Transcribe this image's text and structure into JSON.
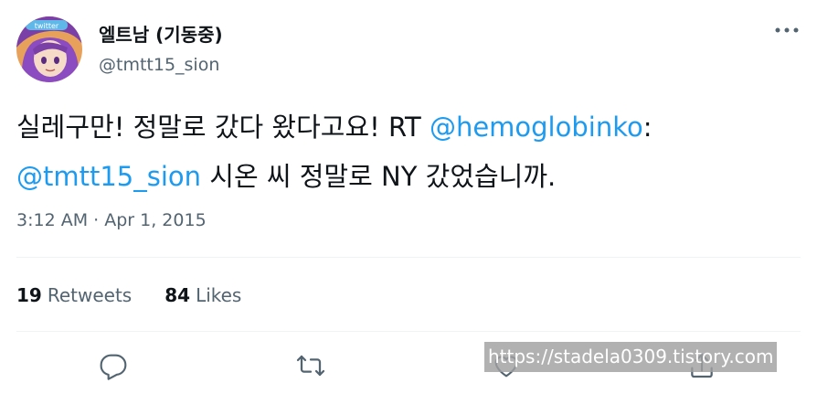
{
  "author": {
    "display_name": "엘트남 (기동중)",
    "handle": "@tmtt15_sion",
    "avatar_banner_text": "twitter"
  },
  "tweet": {
    "text_part1": "실레구만! 정말로 갔다 왔다고요! RT ",
    "mention1": "@hemoglobinko",
    "text_part2": ":",
    "mention2": "@tmtt15_sion",
    "text_part3": " 시온 씨 정말로 NY 갔었습니까.",
    "time": "3:12 AM",
    "separator": " · ",
    "date": "Apr 1, 2015"
  },
  "stats": {
    "retweets_count": "19",
    "retweets_label": "Retweets",
    "likes_count": "84",
    "likes_label": "Likes"
  },
  "icons": {
    "more": "more-dots-icon",
    "reply": "reply-icon",
    "retweet": "retweet-icon",
    "like": "heart-icon",
    "share": "share-icon"
  },
  "colors": {
    "accent": "#1d9bf0",
    "secondary_text": "#536471",
    "primary_text": "#0f1419"
  },
  "watermark": "https://stadela0309.tistory.com"
}
